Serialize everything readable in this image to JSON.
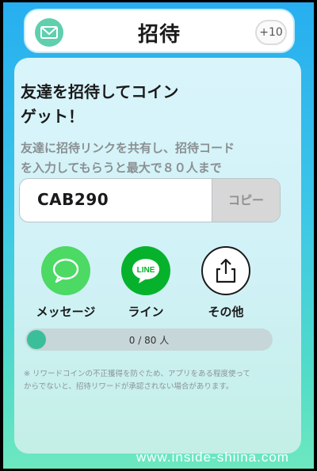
{
  "header": {
    "title": "招待",
    "badge": "+10",
    "mail_icon": "envelope-icon"
  },
  "invite": {
    "headline_line1": "友達を招待してコイン",
    "headline_line2": "ゲット！",
    "description_line1": "友達に招待リンクを共有し、招待コード",
    "description_line2": "を入力してもらうと最大で８０人まで",
    "code": "CAB290",
    "copy_label": "コピー"
  },
  "share": [
    {
      "label": "メッセージ",
      "icon": "speech-bubble-icon",
      "color": "#4cd964"
    },
    {
      "label": "ライン",
      "icon": "line-app-icon",
      "color": "#06b22c"
    },
    {
      "label": "その他",
      "icon": "share-icon",
      "color": "#ffffff"
    }
  ],
  "line_logo_text": "LINE",
  "progress": {
    "current": 0,
    "max": 80,
    "text": "0 / 80 人"
  },
  "note_line1": "※ リワードコインの不正獲得を防ぐため、アプリをある程度使って",
  "note_line2": "からでないと、招待リワードが承認されない場合があります。",
  "watermark": "www.inside-shiina.com"
}
